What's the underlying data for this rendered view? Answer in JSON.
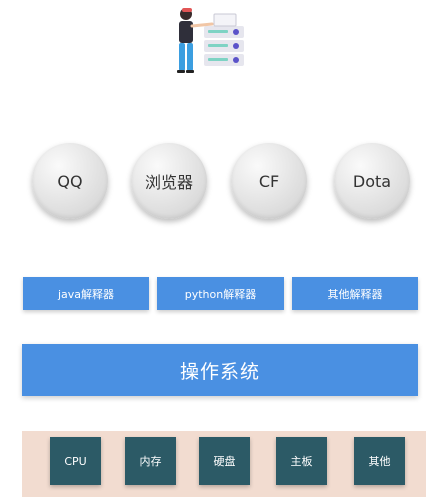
{
  "apps": [
    {
      "label": "QQ"
    },
    {
      "label": "浏览器"
    },
    {
      "label": "CF"
    },
    {
      "label": "Dota"
    }
  ],
  "interpreters": [
    {
      "label": "java解释器"
    },
    {
      "label": "python解释器"
    },
    {
      "label": "其他解释器"
    }
  ],
  "os": {
    "label": "操作系统"
  },
  "hardware": [
    {
      "label": "CPU"
    },
    {
      "label": "内存"
    },
    {
      "label": "硬盘"
    },
    {
      "label": "主板"
    },
    {
      "label": "其他"
    }
  ],
  "colors": {
    "box_blue": "#4a90e2",
    "hardware_box": "#2c5a66",
    "hardware_band": "#f2dcd0",
    "circle_gray": "#e2e2e2"
  },
  "icons": {
    "illustration": "person-with-server-icon"
  }
}
